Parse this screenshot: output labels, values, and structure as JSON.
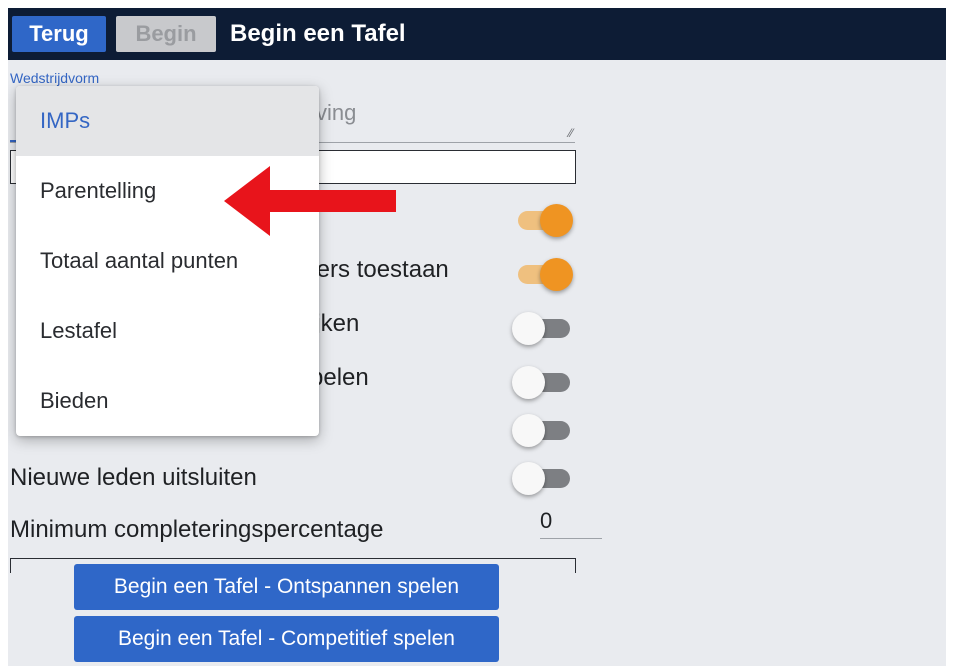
{
  "header": {
    "back_label": "Terug",
    "begin_label": "Begin",
    "title": "Begin een Tafel"
  },
  "form": {
    "competition_form_label": "Wedstrijdvorm",
    "description_placeholder_visible": "ving",
    "settings": [
      {
        "label": "elers toestaan",
        "on": true
      },
      {
        "label": "kijken",
        "on": false
      },
      {
        "label": "spelen",
        "on": false
      },
      {
        "label": "Nieuwe leden uitsluiten",
        "on": false
      }
    ],
    "min_completion_label": "Minimum completeringspercentage",
    "min_completion_value": "0"
  },
  "dropdown": {
    "selected": "IMPs",
    "options": [
      "IMPs",
      "Parentelling",
      "Totaal aantal punten",
      "Lestafel",
      "Bieden"
    ]
  },
  "actions": {
    "casual_label": "Begin een Tafel - Ontspannen spelen",
    "competitive_label": "Begin een Tafel - Competitief spelen"
  },
  "annotation": {
    "arrow_color": "#e8141b",
    "points_to": "Parentelling"
  },
  "colors": {
    "header_bg": "#0d1c35",
    "primary": "#2f67c8",
    "toggle_on": "#ef9422",
    "page_bg": "#e9ebef"
  }
}
